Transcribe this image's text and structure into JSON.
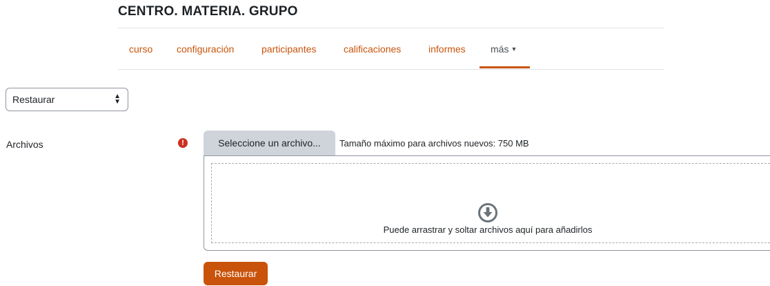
{
  "header": {
    "title": "CENTRO. MATERIA. GRUPO"
  },
  "nav": {
    "tabs": [
      {
        "label": "curso"
      },
      {
        "label": "configuración"
      },
      {
        "label": "participantes"
      },
      {
        "label": "calificaciones"
      },
      {
        "label": "informes"
      },
      {
        "label": "más",
        "active": true
      }
    ]
  },
  "action_select": {
    "selected": "Restaurar"
  },
  "form": {
    "files_label": "Archivos",
    "required_icon": "!",
    "choose_button": "Seleccione un archivo...",
    "max_size": "Tamaño máximo para archivos nuevos: 750 MB",
    "drop_icon": "download-circle-icon",
    "drop_hint": "Puede arrastrar y soltar archivos aquí para añadirlos",
    "submit": "Restaurar"
  },
  "colors": {
    "accent": "#c9530a",
    "required": "#ca3120",
    "button_secondary": "#ced4da"
  }
}
